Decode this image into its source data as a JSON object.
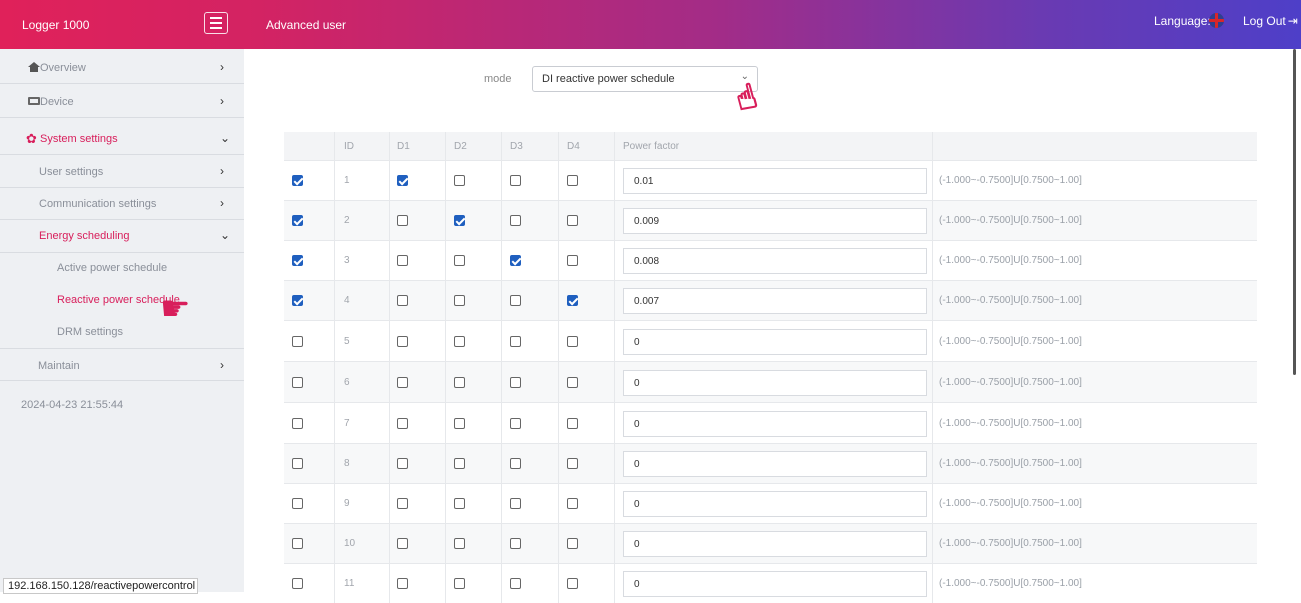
{
  "header": {
    "brand": "Logger 1000",
    "user_role": "Advanced user",
    "language_label": "Language:",
    "logout_label": "Log Out",
    "colors": {
      "gradient_start": "#e0215a",
      "gradient_end": "#4e3fc8"
    }
  },
  "sidebar": {
    "items": [
      {
        "label": "Overview",
        "icon": "home-icon"
      },
      {
        "label": "Device",
        "icon": "device-icon"
      },
      {
        "label": "System settings",
        "icon": "gear-icon"
      },
      {
        "label": "User settings"
      },
      {
        "label": "Communication settings"
      },
      {
        "label": "Energy scheduling"
      },
      {
        "label": "Maintain"
      }
    ],
    "sub_items": [
      {
        "label": "Active power schedule"
      },
      {
        "label": "Reactive power schedule"
      },
      {
        "label": "DRM settings"
      }
    ],
    "timestamp": "2024-04-23 21:55:44",
    "accent": "#d81e5b"
  },
  "status_url": "192.168.150.128/reactivepowercontrol",
  "main": {
    "mode_label": "mode",
    "mode_value": "DI reactive power schedule",
    "columns": [
      "ID",
      "D1",
      "D2",
      "D3",
      "D4",
      "Power factor"
    ],
    "rows": [
      {
        "selected": true,
        "id": "1",
        "d": [
          true,
          false,
          false,
          false
        ],
        "power_factor": "0.01",
        "range": "(-1.000~-0.7500]U[0.7500~1.00]"
      },
      {
        "selected": true,
        "id": "2",
        "d": [
          false,
          true,
          false,
          false
        ],
        "power_factor": "0.009",
        "range": "(-1.000~-0.7500]U[0.7500~1.00]"
      },
      {
        "selected": true,
        "id": "3",
        "d": [
          false,
          false,
          true,
          false
        ],
        "power_factor": "0.008",
        "range": "(-1.000~-0.7500]U[0.7500~1.00]"
      },
      {
        "selected": true,
        "id": "4",
        "d": [
          false,
          false,
          false,
          true
        ],
        "power_factor": "0.007",
        "range": "(-1.000~-0.7500]U[0.7500~1.00]"
      },
      {
        "selected": false,
        "id": "5",
        "d": [
          false,
          false,
          false,
          false
        ],
        "power_factor": "0",
        "range": "(-1.000~-0.7500]U[0.7500~1.00]"
      },
      {
        "selected": false,
        "id": "6",
        "d": [
          false,
          false,
          false,
          false
        ],
        "power_factor": "0",
        "range": "(-1.000~-0.7500]U[0.7500~1.00]"
      },
      {
        "selected": false,
        "id": "7",
        "d": [
          false,
          false,
          false,
          false
        ],
        "power_factor": "0",
        "range": "(-1.000~-0.7500]U[0.7500~1.00]"
      },
      {
        "selected": false,
        "id": "8",
        "d": [
          false,
          false,
          false,
          false
        ],
        "power_factor": "0",
        "range": "(-1.000~-0.7500]U[0.7500~1.00]"
      },
      {
        "selected": false,
        "id": "9",
        "d": [
          false,
          false,
          false,
          false
        ],
        "power_factor": "0",
        "range": "(-1.000~-0.7500]U[0.7500~1.00]"
      },
      {
        "selected": false,
        "id": "10",
        "d": [
          false,
          false,
          false,
          false
        ],
        "power_factor": "0",
        "range": "(-1.000~-0.7500]U[0.7500~1.00]"
      },
      {
        "selected": false,
        "id": "11",
        "d": [
          false,
          false,
          false,
          false
        ],
        "power_factor": "0",
        "range": "(-1.000~-0.7500]U[0.7500~1.00]"
      }
    ]
  }
}
